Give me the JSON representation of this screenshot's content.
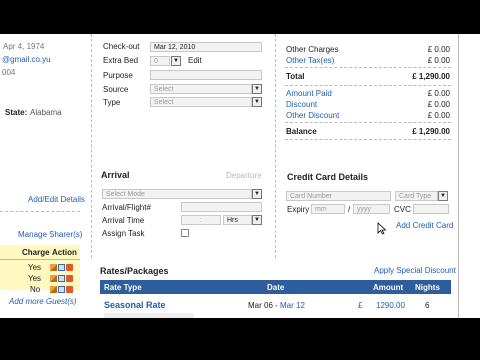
{
  "guest": {
    "dob": "Apr 4, 1974",
    "email": "@gmail.co.yu",
    "misc": "004",
    "state_label": "State:",
    "state_value": "Alabama",
    "add_edit_details": "Add/Edit Details",
    "manage_sharers": "Manage Sharer(s)",
    "sharer_headers": [
      "Charge",
      "Action"
    ],
    "sharers": [
      {
        "charge": "Yes"
      },
      {
        "charge": "Yes"
      },
      {
        "charge": "No"
      }
    ],
    "add_more_guests": "Add more Guest(s)"
  },
  "booking": {
    "checkout_label": "Check-out",
    "checkout_value": "Mar 12, 2010",
    "extra_bed_label": "Extra Bed",
    "extra_bed_value": "0",
    "edit_link": "Edit",
    "purpose_label": "Purpose",
    "source_label": "Source",
    "source_placeholder": "Select",
    "type_label": "Type",
    "type_placeholder": "Select"
  },
  "arrival": {
    "title": "Arrival",
    "departure_tab": "Departure",
    "mode_placeholder": "Select Mode",
    "flight_label": "Arrival/Flight#",
    "time_label": "Arrival Time",
    "time_sep": ":",
    "hrs_label": "Hrs",
    "assign_task_label": "Assign Task"
  },
  "charges": {
    "rows": [
      {
        "label": "Other Charges",
        "value": "£ 0.00",
        "link": false
      },
      {
        "label": "Other Tax(es)",
        "value": "£ 0.00",
        "link": true
      }
    ],
    "total_label": "Total",
    "total_value": "£ 1,290.00",
    "payments": [
      {
        "label": "Amount Paid",
        "value": "£ 0.00"
      },
      {
        "label": "Discount",
        "value": "£ 0.00"
      },
      {
        "label": "Other Discount",
        "value": "£ 0.00"
      }
    ],
    "balance_label": "Balance",
    "balance_value": "£ 1,290.00"
  },
  "credit_card": {
    "title": "Credit Card Details",
    "card_number_placeholder": "Card Number",
    "card_type_placeholder": "Card Type",
    "expiry_label": "Expiry",
    "mm_placeholder": "mm",
    "slash": "/",
    "yyyy_placeholder": "yyyy",
    "cvc_label": "CVC",
    "add_card_link": "Add Credit Card"
  },
  "rates": {
    "title": "Rates/Packages",
    "apply_discount": "Apply Special Discount",
    "headers": {
      "rate_type": "Rate Type",
      "date": "Date",
      "amount": "Amount",
      "nights": "Nights"
    },
    "rows": [
      {
        "name": "Seasonal Rate",
        "date_from": "Mar 06",
        "date_sep": " - ",
        "date_to": "Mar 12",
        "currency": "£",
        "amount": "1290.00",
        "nights": "6"
      }
    ]
  },
  "colors": {
    "header_blue": "#2d5d9a",
    "link_blue": "#1f5fb0",
    "sharer_yellow": "#fff8c0"
  }
}
